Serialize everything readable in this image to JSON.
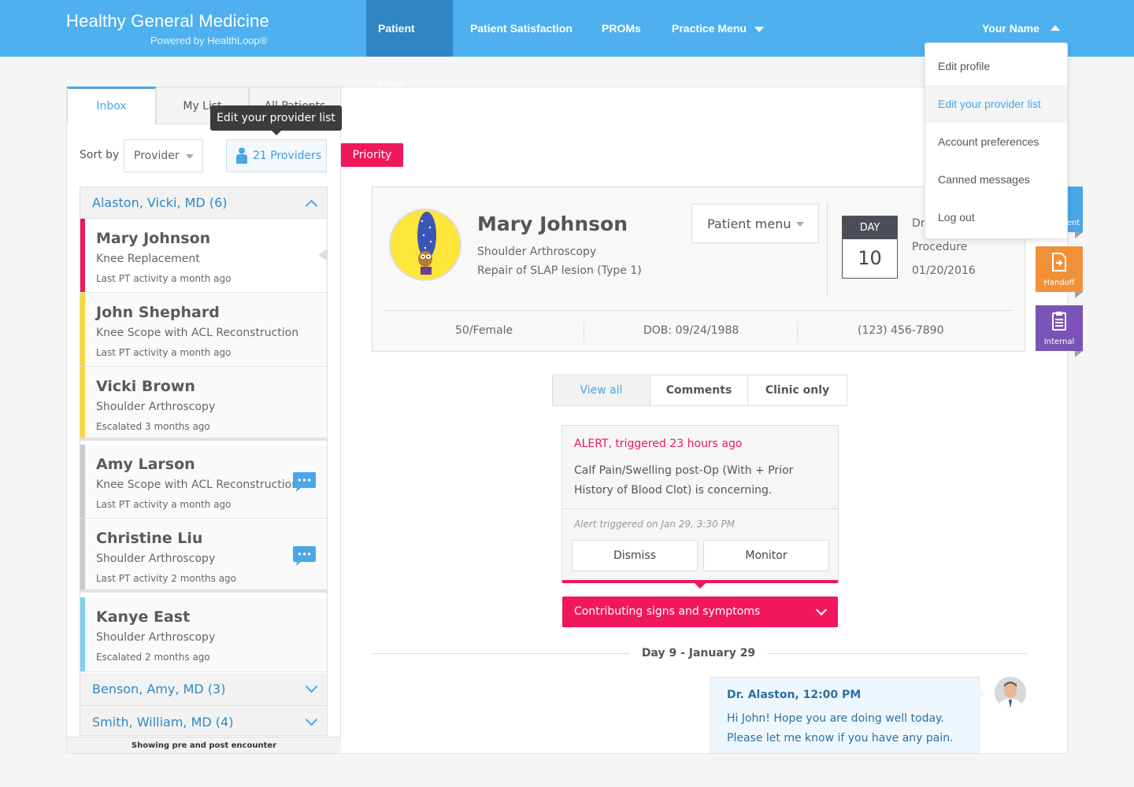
{
  "brand": {
    "title": "Healthy General Medicine",
    "subtitle": "Powered by HealthLoop®"
  },
  "nav": {
    "items": [
      {
        "label": "Patient Care",
        "active": true
      },
      {
        "label": "Patient Satisfaction"
      },
      {
        "label": "PROMs"
      },
      {
        "label": "Practice Menu"
      }
    ],
    "user": "Your Name"
  },
  "user_menu": {
    "items": [
      "Edit profile",
      "Edit your provider list",
      "Account preferences",
      "Canned messages",
      "Log out"
    ],
    "highlighted": "Edit your provider list"
  },
  "left_tabs": [
    "Inbox",
    "My List",
    "All Patients"
  ],
  "sort": {
    "label": "Sort by",
    "value": "Provider"
  },
  "providers_button": "21 Providers",
  "tooltip": "Edit your provider list",
  "priority_badge": "Priority",
  "groups": [
    {
      "label": "Alaston, Vicki, MD (6)",
      "expanded": true
    },
    {
      "label": "Benson, Amy, MD (3)",
      "expanded": false
    },
    {
      "label": "Smith, William, MD (4)",
      "expanded": false
    }
  ],
  "patients": [
    {
      "name": "Mary Johnson",
      "procedure": "Knee Replacement",
      "activity": "Last PT activity a month ago",
      "color": "#f0185a",
      "selected": true
    },
    {
      "name": "John Shephard",
      "procedure": "Knee Scope with ACL Reconstruction",
      "activity": "Last PT activity a month ago",
      "color": "#fbd736"
    },
    {
      "name": "Vicki Brown",
      "procedure": "Shoulder Arthroscopy",
      "activity": "Escalated 3 months ago",
      "color": "#fbd736"
    },
    {
      "name": "Amy Larson",
      "procedure": "Knee Scope with ACL Reconstruction",
      "activity": "Last PT activity a month ago",
      "color": "#c9c9c9",
      "message": true
    },
    {
      "name": "Christine Liu",
      "procedure": "Shoulder Arthroscopy",
      "activity": "Last PT activity 2 months ago",
      "color": "#c9c9c9",
      "message": true
    },
    {
      "name": "Kanye East",
      "procedure": "Shoulder Arthroscopy",
      "activity": "Escalated 2 months ago",
      "color": "#7fd0ea"
    }
  ],
  "list_footer": "Showing pre and post encounter",
  "patient_card": {
    "name": "Mary Johnson",
    "procedure_line1": "Shoulder Arthroscopy",
    "procedure_line2": "Repair of SLAP lesion (Type 1)",
    "menu_label": "Patient menu",
    "day_label": "DAY",
    "day_number": "10",
    "doctor_label": "Dr",
    "procedure_label": "Procedure",
    "procedure_date": "01/20/2016",
    "age_sex": "50/Female",
    "dob": "DOB: 09/24/1988",
    "phone": "(123) 456-7890"
  },
  "side_flags": [
    {
      "label": "ent",
      "color": "#4aa6e6",
      "icon": "message-icon"
    },
    {
      "label": "Handoff",
      "color": "#f0913a",
      "icon": "handoff-document-icon"
    },
    {
      "label": "Internal",
      "color": "#7b53b6",
      "icon": "clipboard-icon"
    }
  ],
  "feed_tabs": [
    {
      "label": "View all",
      "active": true
    },
    {
      "label": "Comments"
    },
    {
      "label": "Clinic only"
    }
  ],
  "alert": {
    "title": "ALERT, triggered 23 hours ago",
    "body": "Calf Pain/Swelling post-Op (With + Prior History of Blood Clot) is concerning.",
    "triggered": "Alert triggered on Jan 29, 3:30 PM",
    "dismiss": "Dismiss",
    "monitor": "Monitor",
    "contributing": "Contributing signs and symptoms"
  },
  "day_divider": "Day 9 - January 29",
  "message": {
    "from": "Dr. Alaston, 12:00 PM",
    "body": "Hi John! Hope you are doing well today. Please let me know if you have any pain."
  }
}
